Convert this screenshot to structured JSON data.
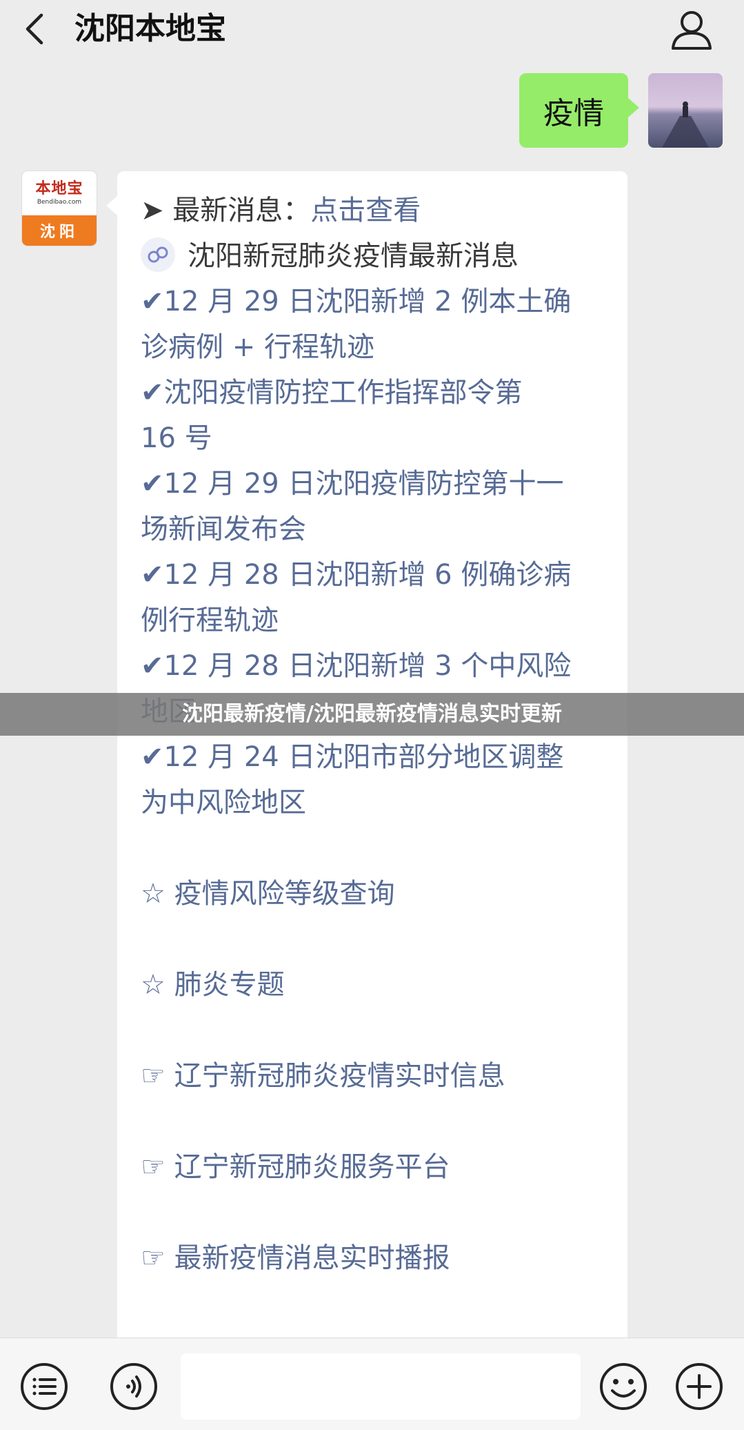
{
  "header": {
    "title": "沈阳本地宝"
  },
  "outgoing": {
    "text": "疫情"
  },
  "bot": {
    "brand": "本地宝",
    "domain": "Bendibao.com",
    "city": "沈阳"
  },
  "message": {
    "line1_prefix": "➤ 最新消息：",
    "line1_link": "点击查看",
    "mp_title": "沈阳新冠肺炎疫情最新消息",
    "lines": [
      "✔12 月 29 日沈阳新增 2 例本土确",
      "诊病例 + 行程轨迹",
      "✔沈阳疫情防控工作指挥部令第",
      "16 号",
      "✔12 月 29 日沈阳疫情防控第十一",
      "场新闻发布会",
      "✔12 月 28 日沈阳新增 6 例确诊病",
      "例行程轨迹",
      "✔12 月 28 日沈阳新增 3 个中风险",
      "地区",
      "✔12 月 24 日沈阳市部分地区调整",
      "为中风险地区"
    ],
    "star_items": [
      "☆ 疫情风险等级查询",
      "☆ 肺炎专题"
    ],
    "hand_items": [
      "☞ 辽宁新冠肺炎疫情实时信息",
      "☞ 辽宁新冠肺炎服务平台",
      "☞ 最新疫情消息实时播报"
    ]
  },
  "banner": {
    "text": "沈阳最新疫情/沈阳最新疫情消息实时更新"
  },
  "input": {
    "placeholder": ""
  },
  "icons": {
    "back": "chevron-left-icon",
    "profile": "user-icon",
    "menu": "list-icon",
    "voice": "voice-icon",
    "emoji": "smiley-icon",
    "more": "plus-icon"
  },
  "colors": {
    "outgoing_bubble": "#95ec69",
    "link": "#576b95",
    "background": "#ececec",
    "brand_orange": "#ef7b21",
    "brand_red": "#c42a1c"
  }
}
